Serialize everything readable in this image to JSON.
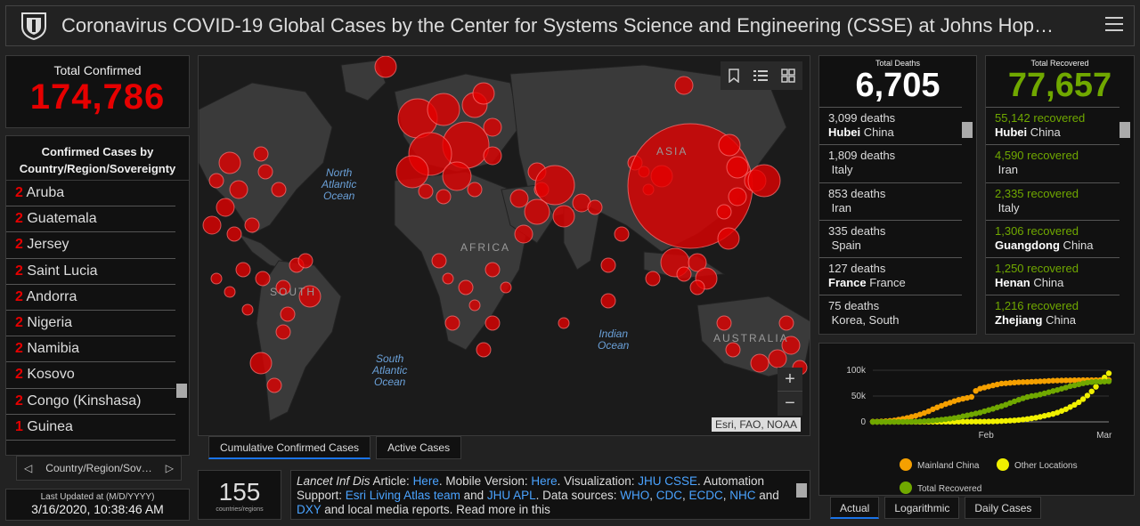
{
  "header": {
    "title": "Coronavirus COVID-19 Global Cases by the Center for Systems Science and Engineering (CSSE) at Johns Hop…"
  },
  "total_confirmed": {
    "label": "Total Confirmed",
    "value": "174,786"
  },
  "country_list": {
    "heading_line1": "Confirmed Cases by",
    "heading_line2": "Country/Region/Sovereignty",
    "items": [
      {
        "num": "2",
        "name": "Aruba"
      },
      {
        "num": "2",
        "name": "Guatemala"
      },
      {
        "num": "2",
        "name": "Jersey"
      },
      {
        "num": "2",
        "name": "Saint Lucia"
      },
      {
        "num": "2",
        "name": "Andorra"
      },
      {
        "num": "2",
        "name": "Nigeria"
      },
      {
        "num": "2",
        "name": "Namibia"
      },
      {
        "num": "2",
        "name": "Kosovo"
      },
      {
        "num": "2",
        "name": "Congo (Kinshasa)"
      },
      {
        "num": "1",
        "name": "Guinea"
      }
    ],
    "nav_label": "Country/Region/Sov…"
  },
  "last_updated": {
    "label": "Last Updated at (M/D/YYYY)",
    "value": "3/16/2020, 10:38:46 AM"
  },
  "map": {
    "attribution": "Esri, FAO, NOAA",
    "oceans": {
      "north_atlantic": [
        "North",
        "Atlantic",
        "Ocean"
      ],
      "south_atlantic": [
        "South",
        "Atlantic",
        "Ocean"
      ],
      "indian": [
        "Indian",
        "Ocean"
      ]
    },
    "continents": {
      "south_america": "SOUTH",
      "africa": "AFRICA",
      "asia": "ASIA",
      "australia": "AUSTRALIA"
    },
    "tabs": [
      "Cumulative Confirmed Cases",
      "Active Cases"
    ]
  },
  "countries_count": {
    "value": "155",
    "label": "countries/regions"
  },
  "info": {
    "p1": "Lancet Inf Dis",
    "p2": " Article: ",
    "l1": "Here",
    "p3": ". Mobile Version: ",
    "l2": "Here",
    "p4": ". Visualization: ",
    "l3": "JHU CSSE",
    "p5": ". Automation Support: ",
    "l4": "Esri Living Atlas team",
    "p6": " and ",
    "l5": "JHU APL",
    "p7": ". Data sources: ",
    "l6": "WHO",
    "p8": ", ",
    "l7": "CDC",
    "p9": ", ",
    "l8": "ECDC",
    "p10": ", ",
    "l9": "NHC",
    "p11": " and ",
    "l10": "DXY",
    "p12": " and local media reports. Read more in this"
  },
  "total_deaths": {
    "label": "Total Deaths",
    "value": "6,705",
    "items": [
      {
        "count": "3,099 deaths",
        "bold": "Hubei",
        "rest": " China"
      },
      {
        "count": "1,809 deaths",
        "bold": "",
        "rest": "Italy"
      },
      {
        "count": "853 deaths",
        "bold": "",
        "rest": "Iran"
      },
      {
        "count": "335 deaths",
        "bold": "",
        "rest": "Spain"
      },
      {
        "count": "127 deaths",
        "bold": "France",
        "rest": " France"
      },
      {
        "count": "75 deaths",
        "bold": "",
        "rest": "Korea, South"
      }
    ]
  },
  "total_recovered": {
    "label": "Total Recovered",
    "value": "77,657",
    "items": [
      {
        "count": "55,142 recovered",
        "bold": "Hubei",
        "rest": " China"
      },
      {
        "count": "4,590 recovered",
        "bold": "",
        "rest": "Iran"
      },
      {
        "count": "2,335 recovered",
        "bold": "",
        "rest": "Italy"
      },
      {
        "count": "1,306 recovered",
        "bold": "Guangdong",
        "rest": " China"
      },
      {
        "count": "1,250 recovered",
        "bold": "Henan",
        "rest": " China"
      },
      {
        "count": "1,216 recovered",
        "bold": "Zhejiang",
        "rest": " China"
      }
    ]
  },
  "chart_data": {
    "type": "scatter",
    "y_ticks": [
      "100k",
      "50k",
      "0"
    ],
    "x_ticks": [
      "Feb",
      "Mar"
    ],
    "ylim": [
      0,
      100000
    ],
    "series": [
      {
        "name": "Mainland China",
        "color": "#f5a000",
        "values": [
          500,
          600,
          900,
          1300,
          2000,
          2800,
          4500,
          6000,
          7700,
          9700,
          11800,
          14400,
          17200,
          20400,
          24500,
          28000,
          31200,
          34500,
          37100,
          40200,
          42700,
          44700,
          46500,
          48300,
          60000,
          64400,
          66500,
          68500,
          70500,
          72400,
          74200,
          74700,
          75500,
          76200,
          76800,
          77100,
          77200,
          77700,
          78100,
          78500,
          78800,
          79300,
          79800,
          80000,
          80200,
          80400,
          80500,
          80600,
          80700,
          80800,
          80900,
          80900,
          81000,
          81000,
          81100,
          81100
        ]
      },
      {
        "name": "Other Locations",
        "color": "#f0f000",
        "values": [
          0,
          0,
          10,
          20,
          30,
          40,
          50,
          60,
          70,
          80,
          100,
          120,
          140,
          160,
          180,
          200,
          230,
          270,
          300,
          330,
          360,
          390,
          430,
          470,
          520,
          560,
          600,
          700,
          850,
          1100,
          1500,
          1900,
          2400,
          2900,
          3600,
          4500,
          5500,
          6800,
          8000,
          9700,
          11700,
          13500,
          15300,
          18000,
          21100,
          24500,
          28800,
          33000,
          38000,
          44000,
          51000,
          59000,
          68000,
          78000,
          86000,
          94000
        ]
      },
      {
        "name": "Total Recovered",
        "color": "#70a800",
        "values": [
          0,
          0,
          0,
          0,
          0,
          50,
          100,
          150,
          250,
          400,
          600,
          900,
          1300,
          1800,
          2500,
          3300,
          4200,
          5100,
          6200,
          7500,
          8900,
          10800,
          12600,
          14400,
          16200,
          18000,
          20600,
          22900,
          25200,
          28000,
          30400,
          33300,
          36600,
          39700,
          42700,
          45500,
          48100,
          50000,
          51200,
          53000,
          55200,
          57400,
          59700,
          61800,
          64200,
          66500,
          69100,
          70700,
          72700,
          74600,
          76000,
          77000,
          77600,
          77657,
          78000,
          78500
        ]
      }
    ]
  },
  "chart_tabs": [
    "Actual",
    "Logarithmic",
    "Daily Cases"
  ]
}
